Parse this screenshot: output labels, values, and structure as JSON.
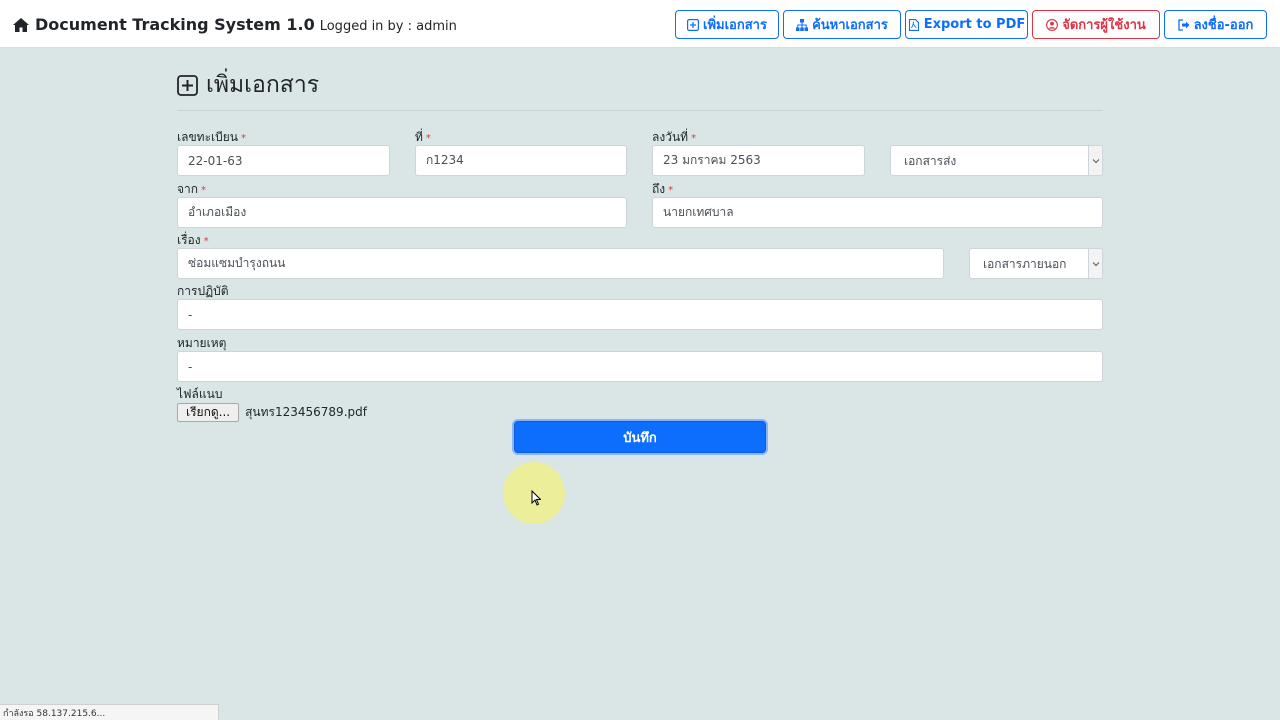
{
  "header": {
    "title": "Document Tracking System 1.0",
    "login_text": "Logged in by : admin",
    "buttons": {
      "add_document": "เพิ่มเอกสาร",
      "search_document": "ค้นหาเอกสาร",
      "export_pdf": "Export to PDF",
      "manage_users": "จัดการผู้ใช้งาน",
      "logout": "ลงชื่อ-ออก"
    }
  },
  "page": {
    "title": "เพิ่มเอกสาร"
  },
  "form": {
    "required_mark": "*",
    "reg_no": {
      "label": "เลขทะเบียน",
      "value": "22-01-63"
    },
    "doc_no": {
      "label": "ที่",
      "value": "ก1234"
    },
    "date": {
      "label": "ลงวันที่",
      "value": "23 มกราคม 2563"
    },
    "doc_direction": {
      "selected": "เอกสารส่ง"
    },
    "from": {
      "label": "จาก",
      "value": "อำเภอเมือง"
    },
    "to": {
      "label": "ถึง",
      "value": "นายกเทศบาล"
    },
    "subject": {
      "label": "เรื่อง",
      "value": "ซ่อมแซมบำรุงถนน"
    },
    "doc_scope": {
      "selected": "เอกสารภายนอก"
    },
    "action": {
      "label": "การปฏิบัติ",
      "value": "-"
    },
    "note": {
      "label": "หมายเหตุ",
      "value": "-"
    },
    "attachment": {
      "label": "ไฟล์แนบ",
      "button": "เรียกดู...",
      "filename": "สุนทร123456789.pdf"
    },
    "save_label": "บันทึก"
  },
  "statusbar": {
    "text": "กำลังรอ 58.137.215.6..."
  },
  "colors": {
    "primary": "#0d6efd",
    "danger": "#dc3545",
    "background": "#dae6e6"
  },
  "icons": {
    "brand": "home-icon",
    "add": "plus-square-icon",
    "search": "sitemap-icon",
    "pdf": "file-pdf-icon",
    "users": "user-circle-icon",
    "logout": "sign-out-icon"
  }
}
